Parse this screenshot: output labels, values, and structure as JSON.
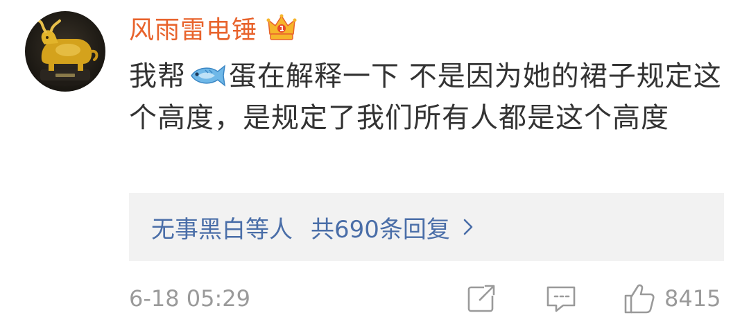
{
  "user": {
    "name": "风雨雷电锤",
    "avatar_icon": "golden-bull-avatar",
    "badge_icon": "crown-icon"
  },
  "comment": {
    "text_before": "我帮",
    "emoji_icon": "fish-icon",
    "text_after": "蛋在解释一下 不是因为她的裙子规定这个高度，是规定了我们所有人都是这个高度"
  },
  "replies": {
    "names": "无事黑白等人",
    "count_label": "共690条回复"
  },
  "footer": {
    "timestamp": "6-18 05:29",
    "like_count": "8415"
  },
  "colors": {
    "username": "#e8632c",
    "link": "#4a6ea8",
    "meta": "#9a9a9a",
    "body_text": "#333333",
    "reply_bg": "#f2f2f2"
  }
}
